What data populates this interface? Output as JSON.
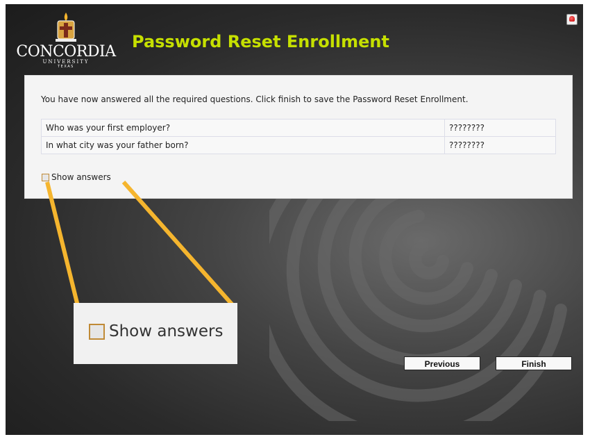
{
  "header": {
    "title": "Password Reset Enrollment",
    "logo": {
      "name": "CONCORDIA",
      "sub": "UNIVERSITY",
      "sub2": "TEXAS"
    },
    "help_icon": "home-icon"
  },
  "panel": {
    "intro": "You have now answered all the required questions. Click finish to save the Password Reset Enrollment.",
    "questions": [
      {
        "question": "Who was your first employer?",
        "answer": "????????"
      },
      {
        "question": "In what city was your father born?",
        "answer": "????????"
      }
    ],
    "show_answers_label": "Show answers",
    "show_answers_checked": false
  },
  "callout": {
    "label": "Show answers"
  },
  "buttons": {
    "previous": "Previous",
    "finish": "Finish"
  },
  "colors": {
    "title": "#c6e000",
    "accent": "#f5b52e"
  }
}
